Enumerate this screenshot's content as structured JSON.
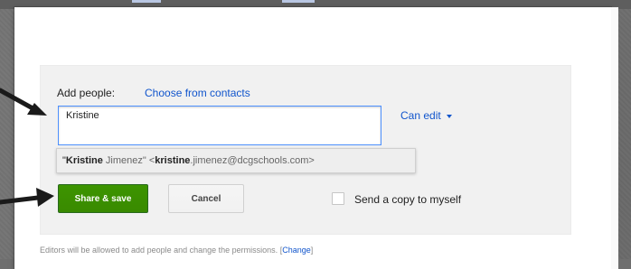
{
  "share_dialog": {
    "add_people_label": "Add people:",
    "choose_from_contacts_link": "Choose from contacts",
    "people_input_value": "Kristine",
    "permission_dropdown": {
      "selected": "Can edit",
      "icon": "chevron-down-icon"
    },
    "suggestion": {
      "name_bold": "Kristine",
      "name_rest": " Jimenez\" <",
      "email_bold": "kristine",
      "email_rest": ".jimenez@dcgschools.com>"
    },
    "share_button_label": "Share & save",
    "cancel_button_label": "Cancel",
    "send_copy_checkbox": {
      "label": "Send a copy to myself",
      "checked": false
    },
    "footer": {
      "note": "Editors will be allowed to add people and change the permissions.",
      "link_open": "[",
      "link": "Change",
      "link_close": "]"
    }
  },
  "annotations": {
    "arrow_color": "#1a1a1a",
    "arrows": [
      "pointer-arrow-icon",
      "pointer-arrow-icon"
    ]
  },
  "colors": {
    "link": "#1155cc",
    "share_button": "#3d9400",
    "input_focus_border": "#4d90fe",
    "panel_background": "#f1f1f1"
  }
}
